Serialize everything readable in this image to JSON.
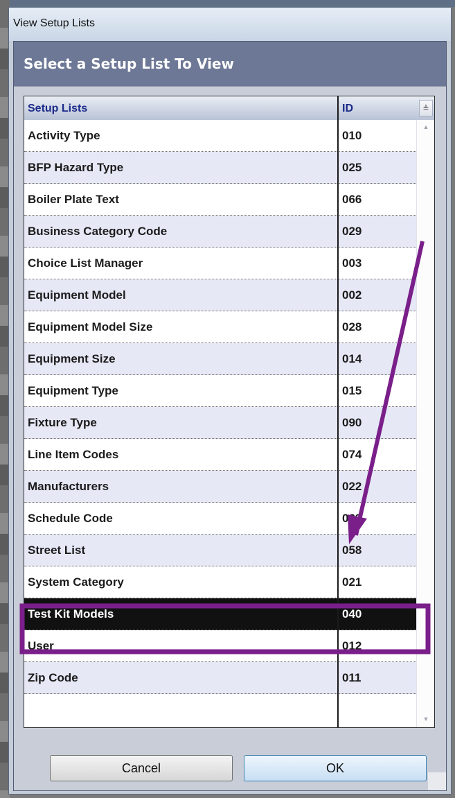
{
  "window": {
    "title": "View Setup Lists"
  },
  "header": {
    "title": "Select a Setup List To View"
  },
  "grid": {
    "columns": [
      "Setup Lists",
      "ID"
    ],
    "sort_icon": "≜",
    "selected_index": 15,
    "rows": [
      {
        "name": "Activity Type",
        "id": "010"
      },
      {
        "name": "BFP Hazard Type",
        "id": "025"
      },
      {
        "name": "Boiler Plate Text",
        "id": "066"
      },
      {
        "name": "Business Category Code",
        "id": "029"
      },
      {
        "name": "Choice List Manager",
        "id": "003"
      },
      {
        "name": "Equipment Model",
        "id": "002"
      },
      {
        "name": "Equipment Model Size",
        "id": "028"
      },
      {
        "name": "Equipment Size",
        "id": "014"
      },
      {
        "name": "Equipment Type",
        "id": "015"
      },
      {
        "name": "Fixture Type",
        "id": "090"
      },
      {
        "name": "Line Item Codes",
        "id": "074"
      },
      {
        "name": "Manufacturers",
        "id": "022"
      },
      {
        "name": "Schedule Code",
        "id": "063"
      },
      {
        "name": "Street List",
        "id": "058"
      },
      {
        "name": "System Category",
        "id": "021"
      },
      {
        "name": "Test Kit Models",
        "id": "040"
      },
      {
        "name": "User",
        "id": "012"
      },
      {
        "name": "Zip Code",
        "id": "011"
      }
    ]
  },
  "buttons": {
    "cancel": "Cancel",
    "ok": "OK"
  },
  "annotation": {
    "color": "#7a1f8a"
  }
}
